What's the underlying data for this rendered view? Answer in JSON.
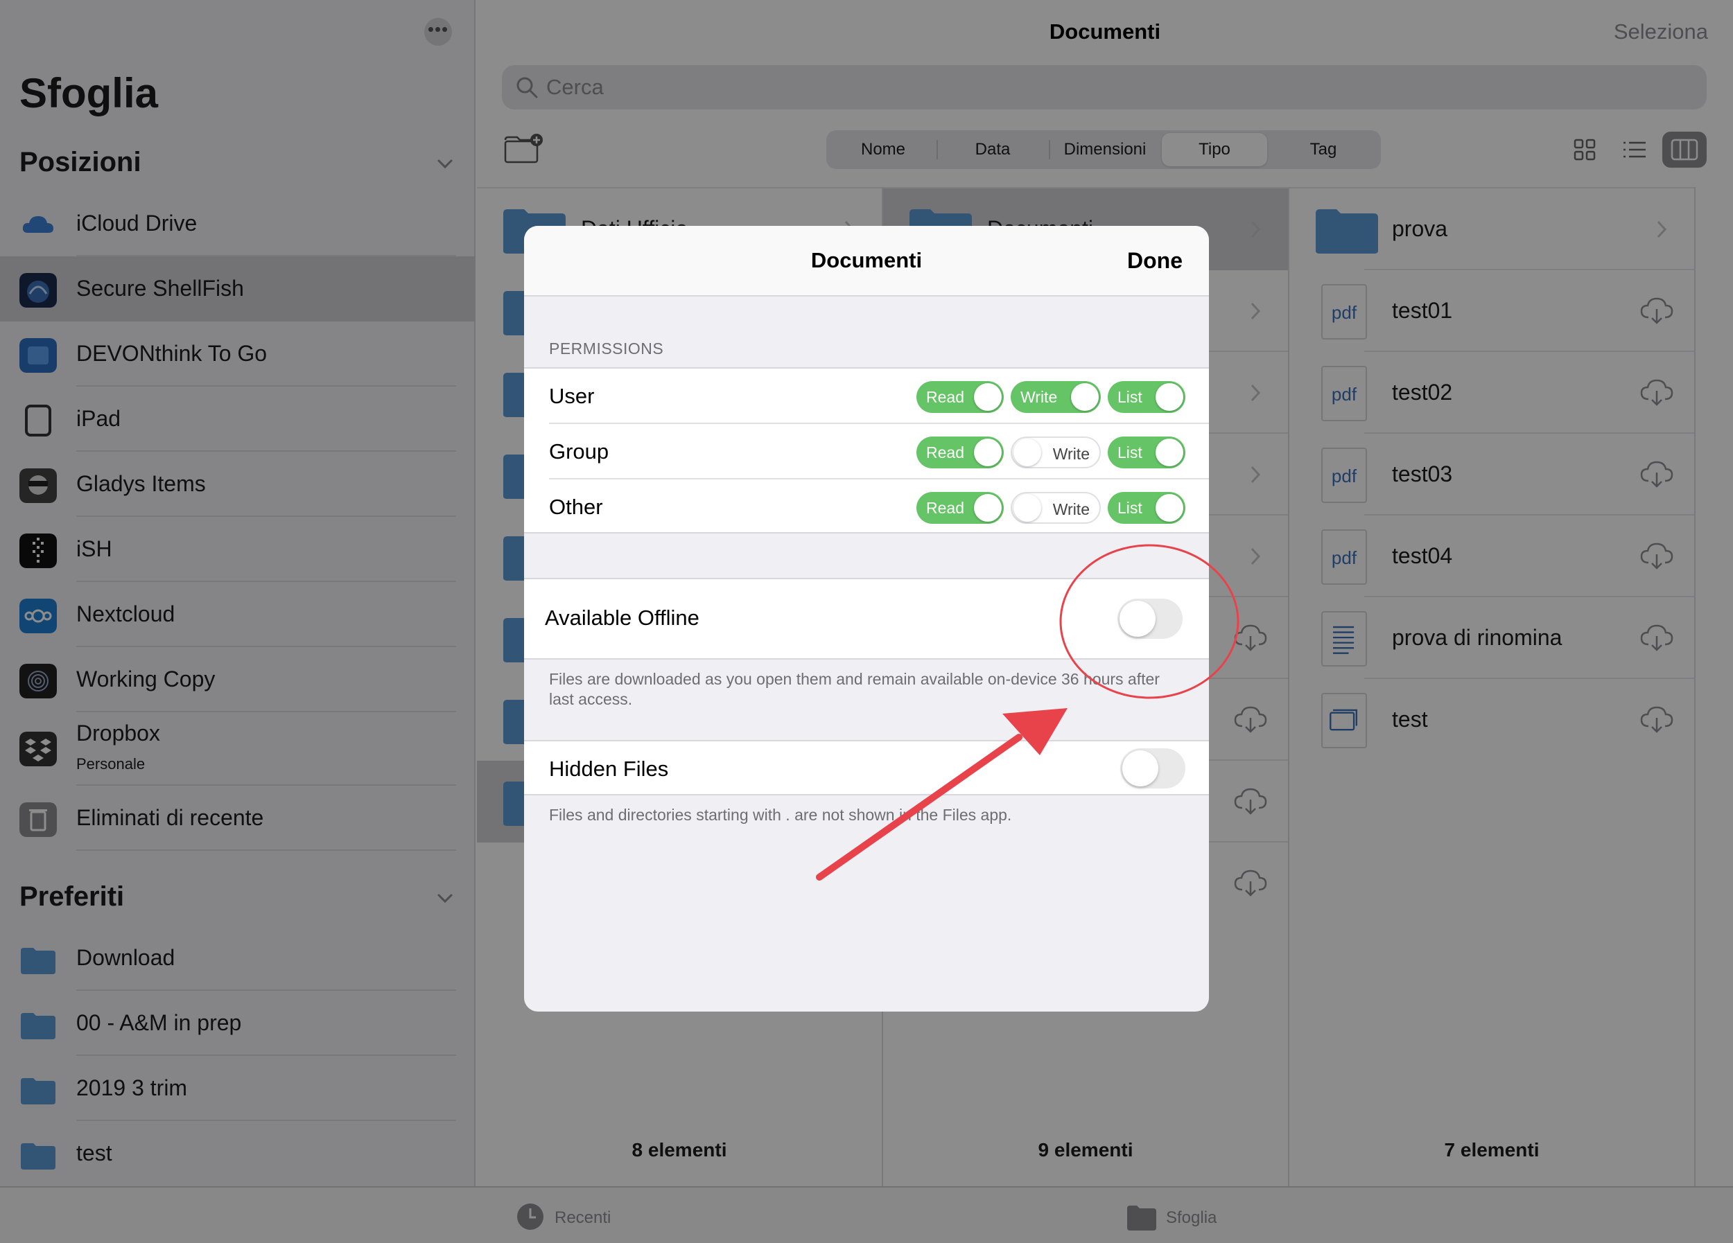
{
  "sidebar": {
    "title": "Sfoglia",
    "locations_header": "Posizioni",
    "favorites_header": "Preferiti",
    "locations": [
      {
        "label": "iCloud Drive",
        "icon": "icloud-icon"
      },
      {
        "label": "Secure ShellFish",
        "icon": "shellfish-icon"
      },
      {
        "label": "DEVONthink To Go",
        "icon": "devonthink-icon"
      },
      {
        "label": "iPad",
        "icon": "ipad-icon"
      },
      {
        "label": "Gladys Items",
        "icon": "gladys-icon"
      },
      {
        "label": "iSH",
        "icon": "ish-icon"
      },
      {
        "label": "Nextcloud",
        "icon": "nextcloud-icon"
      },
      {
        "label": "Working Copy",
        "icon": "working-copy-icon"
      },
      {
        "label": "Dropbox",
        "sublabel": "Personale",
        "icon": "dropbox-icon"
      },
      {
        "label": "Eliminati di recente",
        "icon": "trash-icon"
      }
    ],
    "favorites": [
      {
        "label": "Download"
      },
      {
        "label": "00 - A&M in prep"
      },
      {
        "label": "2019 3 trim"
      },
      {
        "label": "test"
      }
    ]
  },
  "header": {
    "title": "Documenti",
    "select_label": "Seleziona",
    "search_placeholder": "Cerca",
    "sort_options": [
      "Nome",
      "Data",
      "Dimensioni",
      "Tipo",
      "Tag"
    ],
    "active_sort": "Tipo"
  },
  "columns": {
    "col1_count": "8 elementi",
    "col2_count": "9 elementi",
    "col3_count": "7 elementi",
    "col1_item0": "Dati Ufficio",
    "col2_item0": "Documenti",
    "col3_items": [
      {
        "label": "prova",
        "type": "folder"
      },
      {
        "label": "test01",
        "type": "pdf",
        "badge": "pdf"
      },
      {
        "label": "test02",
        "type": "pdf",
        "badge": "pdf"
      },
      {
        "label": "test03",
        "type": "pdf",
        "badge": "pdf"
      },
      {
        "label": "test04",
        "type": "pdf",
        "badge": "pdf"
      },
      {
        "label": "prova di rinomina",
        "type": "text"
      },
      {
        "label": "test",
        "type": "window"
      }
    ]
  },
  "tabbar": {
    "recent": "Recenti",
    "browse": "Sfoglia"
  },
  "modal": {
    "title": "Documenti",
    "done": "Done",
    "permissions_header": "PERMISSIONS",
    "rows": [
      {
        "label": "User",
        "read": "Read",
        "write": "Write",
        "list": "List",
        "read_on": true,
        "write_on": true,
        "list_on": true
      },
      {
        "label": "Group",
        "read": "Read",
        "write": "Write",
        "list": "List",
        "read_on": true,
        "write_on": false,
        "list_on": true
      },
      {
        "label": "Other",
        "read": "Read",
        "write": "Write",
        "list": "List",
        "read_on": true,
        "write_on": false,
        "list_on": true
      }
    ],
    "offline_label": "Available Offline",
    "offline_on": false,
    "offline_note": "Files are downloaded as you open them and remain available on-device 36 hours after last access.",
    "hidden_label": "Hidden Files",
    "hidden_on": false,
    "hidden_note": "Files and directories starting with . are not shown in the Files app."
  },
  "colors": {
    "toggle_on": "#65c466",
    "folder": "#5b9bd5",
    "annotation_red": "#e8434b"
  }
}
